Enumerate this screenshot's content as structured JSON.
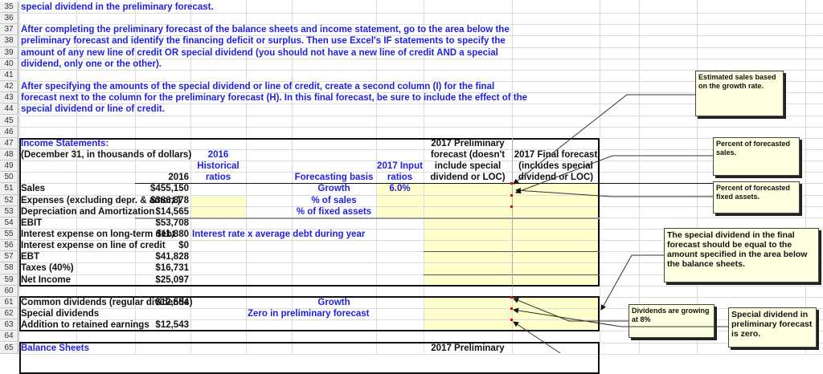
{
  "rows": [
    {
      "n": 35,
      "cells": [
        {
          "col": "A",
          "text": "special dividend in the preliminary forecast.",
          "cls": "blue"
        }
      ]
    },
    {
      "n": 36,
      "cells": []
    },
    {
      "n": 37,
      "cells": [
        {
          "col": "A",
          "text": "After completing the preliminary forecast of the balance sheets and income statement, go to the area below the",
          "cls": "blue"
        }
      ]
    },
    {
      "n": 38,
      "cells": [
        {
          "col": "A",
          "text": "preliminary forecast and identify the financing deficit or surplus. Then use Excel's IF statements to specify the",
          "cls": "blue"
        }
      ]
    },
    {
      "n": 39,
      "cells": [
        {
          "col": "A",
          "text": "amount of any new line of credit OR special dividend (you should not have a new line of credit AND a special",
          "cls": "blue"
        }
      ]
    },
    {
      "n": 40,
      "cells": [
        {
          "col": "A",
          "text": "dividend, only one or the other).",
          "cls": "blue"
        }
      ]
    },
    {
      "n": 41,
      "cells": []
    },
    {
      "n": 42,
      "cells": [
        {
          "col": "A",
          "text": "After specifying the amounts of the special dividend or line of credit, create a second column (I) for the final",
          "cls": "blue"
        }
      ]
    },
    {
      "n": 43,
      "cells": [
        {
          "col": "A",
          "text": "forecast next to the column for the preliminary forecast (H). In this final forecast, be sure to include the effect of the",
          "cls": "blue"
        }
      ]
    },
    {
      "n": 44,
      "cells": [
        {
          "col": "A",
          "text": "special dividend or line of credit.",
          "cls": "blue"
        }
      ]
    },
    {
      "n": 45,
      "cells": []
    },
    {
      "n": 46,
      "cells": []
    },
    {
      "n": 47,
      "cells": [
        {
          "col": "A",
          "text": "Income Statements:",
          "cls": "blue"
        },
        {
          "col": "H",
          "text": "2017 Preliminary",
          "cls": "blk c"
        }
      ]
    },
    {
      "n": 48,
      "cells": [
        {
          "col": "A",
          "text": "(December 31, in thousands of dollars)",
          "cls": "blk"
        },
        {
          "col": "D",
          "text": "2016",
          "cls": "blue c"
        },
        {
          "col": "H",
          "text": "forecast (doesn't",
          "cls": "blk c"
        },
        {
          "col": "I",
          "text": "2017 Final forecast",
          "cls": "blk c"
        }
      ]
    },
    {
      "n": 49,
      "cells": [
        {
          "col": "D",
          "text": "Historical",
          "cls": "blue c"
        },
        {
          "col": "G",
          "text": "2017 Input",
          "cls": "blue c"
        },
        {
          "col": "H",
          "text": "include special",
          "cls": "blk c"
        },
        {
          "col": "I",
          "text": "(includes special",
          "cls": "blk c"
        }
      ]
    },
    {
      "n": 50,
      "cells": [
        {
          "col": "C",
          "text": "2016",
          "cls": "blk r"
        },
        {
          "col": "D",
          "text": "ratios",
          "cls": "blue c"
        },
        {
          "col": "F",
          "text": "Forecasting basis",
          "cls": "blue c"
        },
        {
          "col": "G",
          "text": "ratios",
          "cls": "blue c"
        },
        {
          "col": "H",
          "text": "dividend or LOC)",
          "cls": "blk c"
        },
        {
          "col": "I",
          "text": "dividend or LOC)",
          "cls": "blk c"
        }
      ]
    },
    {
      "n": 51,
      "cells": [
        {
          "col": "A",
          "text": "Sales",
          "cls": "blk"
        },
        {
          "col": "C",
          "text": "$455,150",
          "cls": "blk r"
        },
        {
          "col": "F",
          "text": "Growth",
          "cls": "blue c"
        },
        {
          "col": "G",
          "text": "6.0%",
          "cls": "blue c"
        }
      ]
    },
    {
      "n": 52,
      "cells": [
        {
          "col": "A",
          "text": "Expenses (excluding depr. & amort.)",
          "cls": "blk"
        },
        {
          "col": "C",
          "text": "$386,878",
          "cls": "blk r"
        },
        {
          "col": "F",
          "text": "% of sales",
          "cls": "blue c"
        }
      ]
    },
    {
      "n": 53,
      "cells": [
        {
          "col": "A",
          "text": "Depreciation and Amortization",
          "cls": "blk"
        },
        {
          "col": "C",
          "text": "$14,565",
          "cls": "blk r"
        },
        {
          "col": "F",
          "text": "% of fixed assets",
          "cls": "blue c"
        }
      ]
    },
    {
      "n": 54,
      "cells": [
        {
          "col": "A",
          "text": "  EBIT",
          "cls": "blk"
        },
        {
          "col": "C",
          "text": "$53,708",
          "cls": "blk r"
        }
      ]
    },
    {
      "n": 55,
      "cells": [
        {
          "col": "A",
          "text": "Interest expense on long-term debt",
          "cls": "blk"
        },
        {
          "col": "C",
          "text": "$11,880",
          "cls": "blk r"
        },
        {
          "col": "D",
          "text": "Interest rate x average debt during year",
          "cls": "blue"
        }
      ]
    },
    {
      "n": 56,
      "cells": [
        {
          "col": "A",
          "text": "Interest expense on line of credit",
          "cls": "blk"
        },
        {
          "col": "C",
          "text": "$0",
          "cls": "blk r"
        }
      ]
    },
    {
      "n": 57,
      "cells": [
        {
          "col": "A",
          "text": "  EBT",
          "cls": "blk"
        },
        {
          "col": "C",
          "text": "$41,828",
          "cls": "blk r"
        }
      ]
    },
    {
      "n": 58,
      "cells": [
        {
          "col": "A",
          "text": "Taxes (40%)",
          "cls": "blk"
        },
        {
          "col": "C",
          "text": "$16,731",
          "cls": "blk r"
        }
      ]
    },
    {
      "n": 59,
      "cells": [
        {
          "col": "A",
          "text": "  Net Income",
          "cls": "blk"
        },
        {
          "col": "C",
          "text": "$25,097",
          "cls": "blk r"
        }
      ]
    },
    {
      "n": 60,
      "cells": []
    },
    {
      "n": 61,
      "cells": [
        {
          "col": "A",
          "text": "Common dividends (regular dividends)",
          "cls": "blk"
        },
        {
          "col": "C",
          "text": "$12,554",
          "cls": "blk r"
        },
        {
          "col": "F",
          "text": "Growth",
          "cls": "blue c"
        }
      ]
    },
    {
      "n": 62,
      "cells": [
        {
          "col": "A",
          "text": "Special dividends",
          "cls": "blk"
        },
        {
          "col": "E",
          "text": "Zero in preliminary forecast",
          "cls": "blue"
        }
      ]
    },
    {
      "n": 63,
      "cells": [
        {
          "col": "A",
          "text": "Addition to retained earnings",
          "cls": "blk"
        },
        {
          "col": "C",
          "text": "$12,543",
          "cls": "blk r"
        }
      ]
    },
    {
      "n": 64,
      "cells": []
    },
    {
      "n": 65,
      "cells": [
        {
          "col": "A",
          "text": "Balance Sheets",
          "cls": "blue"
        },
        {
          "col": "H",
          "text": "2017 Preliminary",
          "cls": "blk c"
        }
      ]
    }
  ],
  "comments": [
    {
      "id": "estimated-sales",
      "text": "Estimated sales based on the growth rate."
    },
    {
      "id": "percent-sales",
      "text": "Percent of forecasted sales."
    },
    {
      "id": "percent-fixed-assets",
      "text": "Percent of forecasted fixed assets."
    },
    {
      "id": "special-dividend-final",
      "text": "The special dividend in the final forecast should be equal to the amount specified in the area below the balance sheets."
    },
    {
      "id": "dividends-growing",
      "text": "Dividends are growing at 8%"
    },
    {
      "id": "special-dividend-zero",
      "text": "Special dividend in preliminary forecast is zero."
    }
  ],
  "colors": {
    "instruction_text": "#1f1fe0",
    "input_fill": "#ffffcc",
    "comment_fill": "#ffffe1"
  }
}
